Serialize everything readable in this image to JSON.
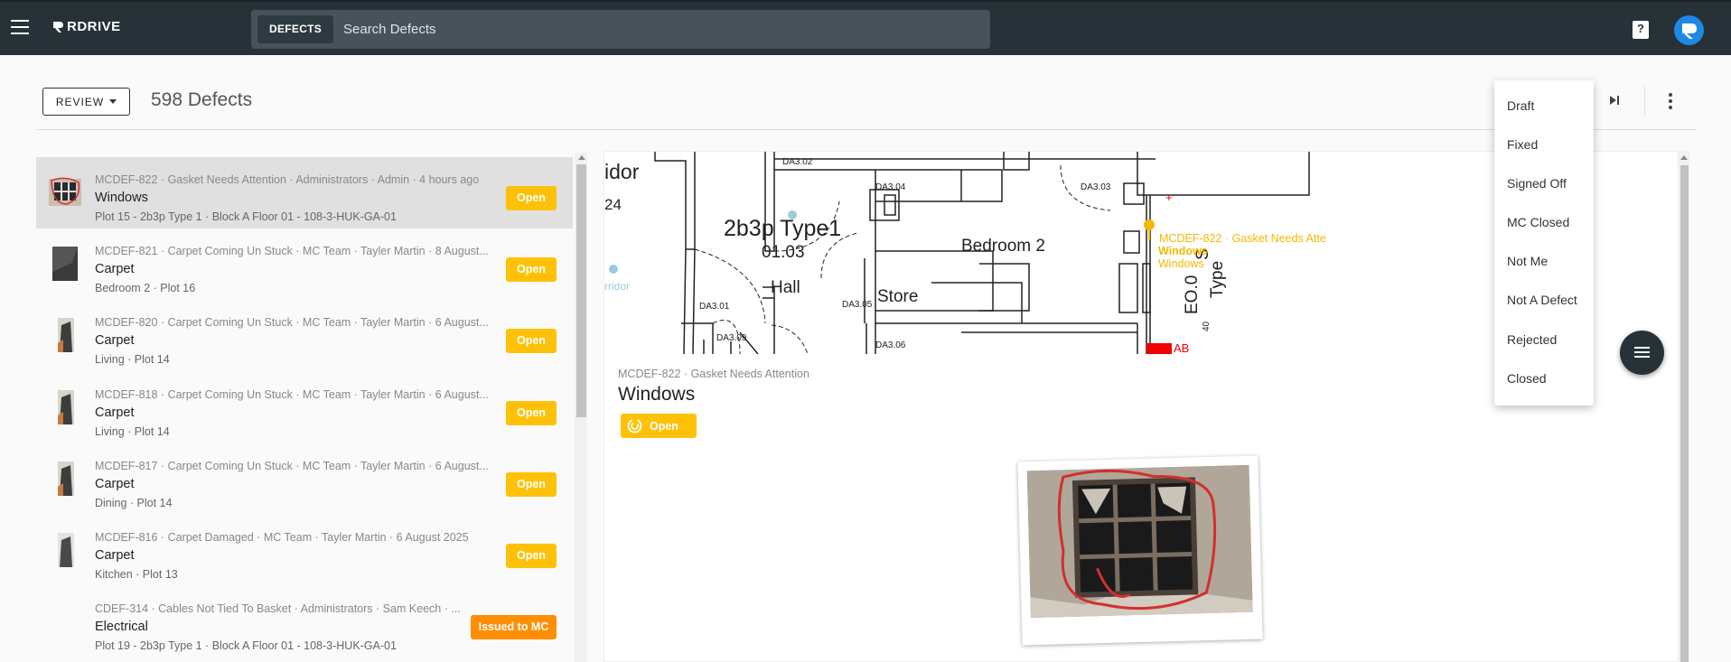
{
  "app": {
    "logo_text": "RDRIVE"
  },
  "search": {
    "chip_label": "DEFECTS",
    "placeholder": "Search Defects"
  },
  "header": {
    "review_label": "REVIEW",
    "defect_count": "598 Defects"
  },
  "status_menu": {
    "items": [
      "Draft",
      "Fixed",
      "Signed Off",
      "MC Closed",
      "Not Me",
      "Not A Defect",
      "Rejected",
      "Closed"
    ]
  },
  "list": {
    "items": [
      {
        "meta": "MCDEF-822 · Gasket Needs Attention · Administrators · Admin · 4 hours ago",
        "title": "Windows",
        "sub": "Plot 15 - 2b3p Type 1 · Block A Floor 01 - 108-3-HUK-GA-01",
        "status": "Open",
        "thumb": "window-icon"
      },
      {
        "meta": "MCDEF-821 · Carpet Coming Un Stuck · MC Team · Tayler Martin · 8 August...",
        "title": "Carpet",
        "sub": "Bedroom 2 · Plot 16",
        "status": "Open",
        "thumb": "carpet-icon"
      },
      {
        "meta": "MCDEF-820 · Carpet Coming Un Stuck · MC Team · Tayler Martin · 6 August...",
        "title": "Carpet",
        "sub": "Living · Plot 14",
        "status": "Open",
        "thumb": "carpet-icon"
      },
      {
        "meta": "MCDEF-818 · Carpet Coming Un Stuck · MC Team · Tayler Martin · 6 August...",
        "title": "Carpet",
        "sub": "Living · Plot 14",
        "status": "Open",
        "thumb": "carpet-icon"
      },
      {
        "meta": "MCDEF-817 · Carpet Coming Un Stuck · MC Team · Tayler Martin · 6 August...",
        "title": "Carpet",
        "sub": "Dining · Plot 14",
        "status": "Open",
        "thumb": "carpet-icon"
      },
      {
        "meta": "MCDEF-816 · Carpet Damaged · MC Team · Tayler Martin · 6 August 2025",
        "title": "Carpet",
        "sub": "Kitchen · Plot 13",
        "status": "Open",
        "thumb": "carpet-icon"
      },
      {
        "meta": "CDEF-314 · Cables Not Tied To Basket · Administrators · Sam Keech · ...",
        "title": "Electrical",
        "sub": "Plot 19 - 2b3p Type 1 · Block A Floor 01 - 108-3-HUK-GA-01",
        "status": "Issued to MC",
        "thumb": ""
      }
    ]
  },
  "detail": {
    "meta": "MCDEF-822 · Gasket Needs Attention",
    "title": "Windows",
    "status": "Open",
    "plan_labels": {
      "corridor": "idor",
      "corridor_num": "24",
      "corridor2": "rridor",
      "type": "2b3p Type1",
      "type_num": "01.03",
      "hall": "Hall",
      "bedroom": "Bedroom 2",
      "store": "Store",
      "da302": "DA3.02",
      "da304": "DA3.04",
      "da303": "DA3.03",
      "da301": "DA3.01",
      "da305": "DA3.05",
      "da309": "DA3.09",
      "da306": "DA3.06",
      "pin_title": "MCDEF-822 · Gasket Needs Atte...",
      "pin_line1": "Windows",
      "pin_line2": "Windows",
      "ab": "AB",
      "vert_eo": "EO.0",
      "vert_type": "Type",
      "vert_s": "S",
      "dim_40": "40"
    }
  },
  "colors": {
    "topbar": "#263238",
    "open": "#ffc107",
    "issued": "#ff8f00",
    "avatar": "#1e88e5"
  }
}
